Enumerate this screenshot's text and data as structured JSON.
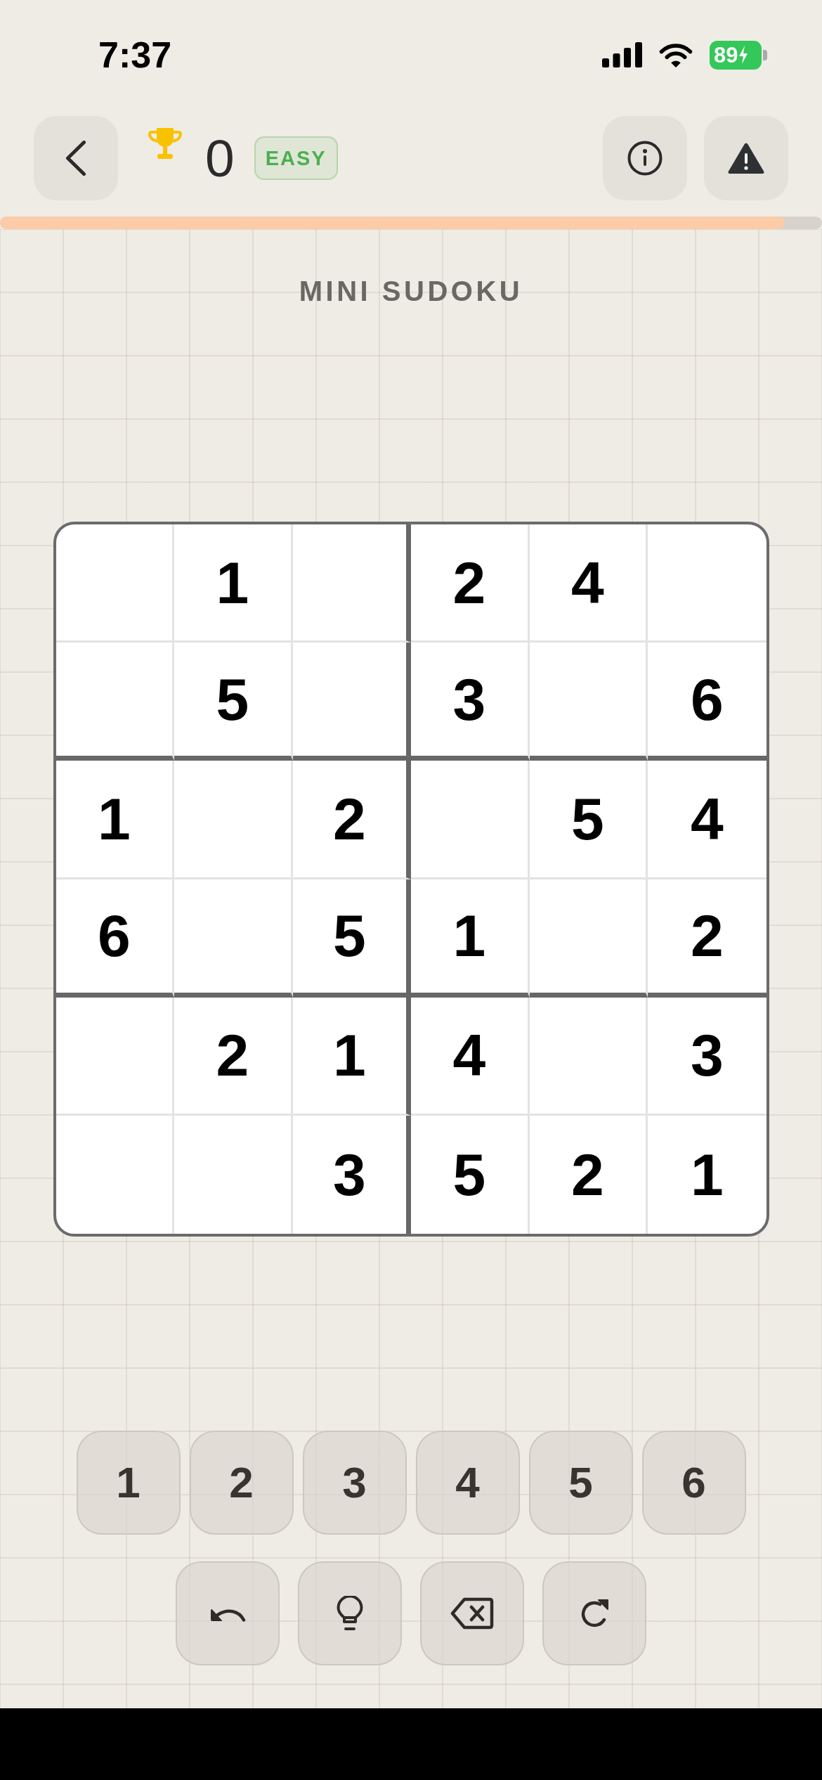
{
  "status_bar": {
    "time": "7:37",
    "battery": "89"
  },
  "header": {
    "score": "0",
    "difficulty": "EASY",
    "progress": {
      "level": 0.955
    }
  },
  "title": "MINI SUDOKU",
  "board": {
    "rows": [
      [
        null,
        "1",
        null,
        "2",
        "4",
        null
      ],
      [
        null,
        "5",
        null,
        "3",
        null,
        "6"
      ],
      [
        "1",
        null,
        "2",
        null,
        "5",
        "4"
      ],
      [
        "6",
        null,
        "5",
        "1",
        null,
        "2"
      ],
      [
        null,
        "2",
        "1",
        "4",
        null,
        "3"
      ],
      [
        null,
        null,
        "3",
        "5",
        "2",
        "1"
      ]
    ]
  },
  "number_pad": [
    "1",
    "2",
    "3",
    "4",
    "5",
    "6"
  ],
  "actions": [
    {
      "kind": "undo"
    },
    {
      "kind": "hint"
    },
    {
      "kind": "erase"
    },
    {
      "kind": "restart"
    }
  ]
}
